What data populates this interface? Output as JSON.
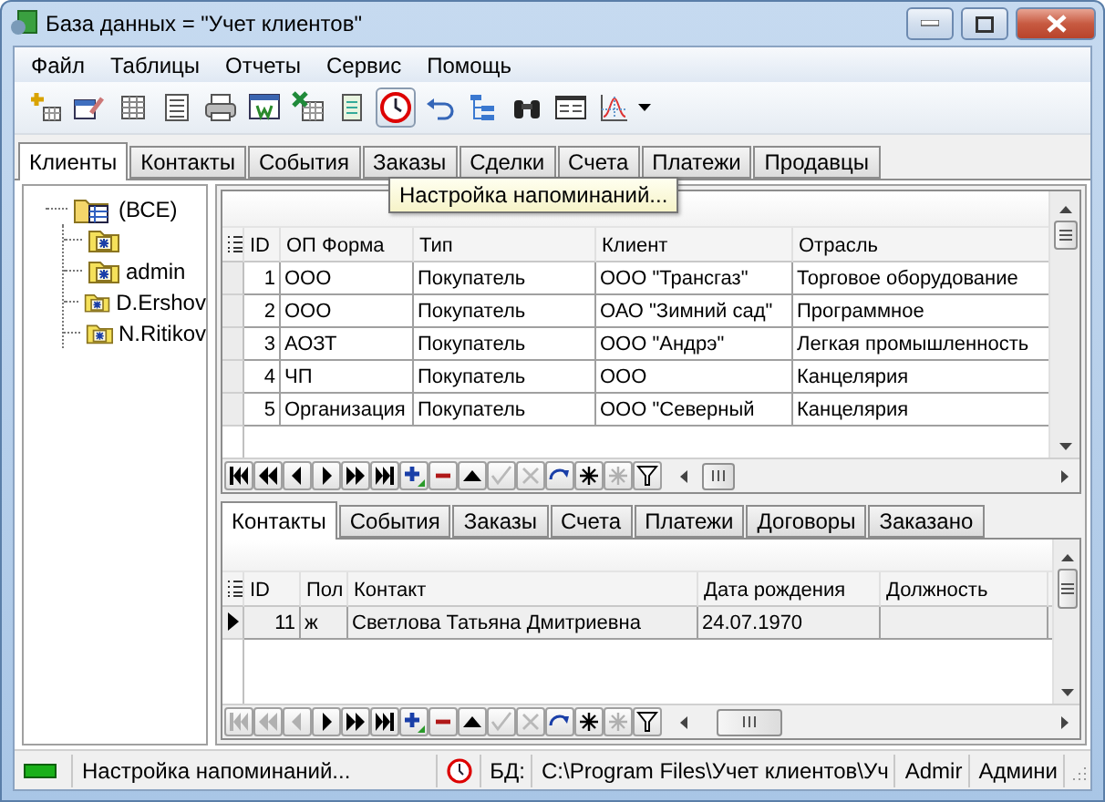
{
  "window": {
    "title": "База данных = \"Учет клиентов\""
  },
  "menu": [
    "Файл",
    "Таблицы",
    "Отчеты",
    "Сервис",
    "Помощь"
  ],
  "toolbar": {
    "buttons": [
      {
        "pressed": false
      },
      {
        "pressed": false
      },
      {
        "pressed": false
      },
      {
        "pressed": false
      },
      {
        "pressed": false
      },
      {
        "pressed": false
      },
      {
        "pressed": false
      },
      {
        "pressed": false
      },
      {
        "pressed": true
      },
      {
        "pressed": false
      },
      {
        "pressed": false
      },
      {
        "pressed": false
      },
      {
        "pressed": false
      },
      {
        "pressed": false
      }
    ]
  },
  "tooltip": "Настройка напоминаний...",
  "tabs": [
    {
      "label": "Клиенты",
      "selected": true
    },
    {
      "label": "Контакты",
      "selected": false
    },
    {
      "label": "События",
      "selected": false
    },
    {
      "label": "Заказы",
      "selected": false
    },
    {
      "label": "Сделки",
      "selected": false
    },
    {
      "label": "Счета",
      "selected": false
    },
    {
      "label": "Платежи",
      "selected": false
    },
    {
      "label": "Продавцы",
      "selected": false
    }
  ],
  "tree": {
    "label": "(ВСЕ)",
    "children": [
      {
        "kind": "user"
      },
      {
        "kind": "user",
        "label": "admin"
      },
      {
        "kind": "user",
        "label": "D.Ershov"
      },
      {
        "kind": "user",
        "label": "N.Ritikov"
      }
    ]
  },
  "clients_grid": {
    "columns": [
      "ID",
      "ОП Форма",
      "Тип",
      "Клиент",
      "Отрасль"
    ],
    "rows": [
      {
        "current": false,
        "cells": [
          "1",
          "ООО",
          "Покупатель",
          "ООО \"Трансгаз\"",
          "Торговое оборудование"
        ]
      },
      {
        "current": false,
        "cells": [
          "2",
          "ООО",
          "Покупатель",
          "ОАО \"Зимний сад\"",
          "Программное"
        ]
      },
      {
        "current": false,
        "cells": [
          "3",
          "АОЗТ",
          "Покупатель",
          "ООО \"Андрэ\"",
          "Легкая промышленность"
        ]
      },
      {
        "current": false,
        "cells": [
          "4",
          "ЧП",
          "Покупатель",
          "ООО",
          "Канцелярия"
        ]
      },
      {
        "current": false,
        "cells": [
          "5",
          "Организация",
          "Покупатель",
          "ООО \"Северный",
          "Канцелярия"
        ]
      }
    ],
    "navigator": [
      {
        "disabled": false
      },
      {
        "disabled": false
      },
      {
        "disabled": false
      },
      {
        "disabled": false
      },
      {
        "disabled": false
      },
      {
        "disabled": false
      },
      {
        "disabled": false
      },
      {
        "disabled": false
      },
      {
        "disabled": false
      },
      {
        "disabled": true
      },
      {
        "disabled": true
      },
      {
        "disabled": false
      },
      {
        "disabled": false
      },
      {
        "disabled": true
      },
      {
        "disabled": false
      }
    ]
  },
  "detail_tabs": [
    {
      "label": "Контакты",
      "selected": true
    },
    {
      "label": "События",
      "selected": false
    },
    {
      "label": "Заказы",
      "selected": false
    },
    {
      "label": "Счета",
      "selected": false
    },
    {
      "label": "Платежи",
      "selected": false
    },
    {
      "label": "Договоры",
      "selected": false
    },
    {
      "label": "Заказано",
      "selected": false
    }
  ],
  "contacts_grid": {
    "columns": [
      "ID",
      "Пол",
      "Контакт",
      "Дата рождения",
      "Должность"
    ],
    "rows": [
      {
        "current": true,
        "cells": [
          "11",
          "ж",
          "Светлова Татьяна Дмитриевна",
          "24.07.1970"
        ]
      }
    ],
    "navigator": [
      {
        "disabled": true
      },
      {
        "disabled": true
      },
      {
        "disabled": true
      },
      {
        "disabled": false
      },
      {
        "disabled": false
      },
      {
        "disabled": false
      },
      {
        "disabled": false
      },
      {
        "disabled": false
      },
      {
        "disabled": false
      },
      {
        "disabled": true
      },
      {
        "disabled": true
      },
      {
        "disabled": false
      },
      {
        "disabled": false
      },
      {
        "disabled": true
      },
      {
        "disabled": false
      }
    ]
  },
  "status_bar": {
    "message": "Настройка напоминаний...",
    "db_label": "БД:",
    "db_path": "C:\\Program Files\\Учет клиентов\\Уч",
    "user": "Admir",
    "role": "Админи"
  }
}
